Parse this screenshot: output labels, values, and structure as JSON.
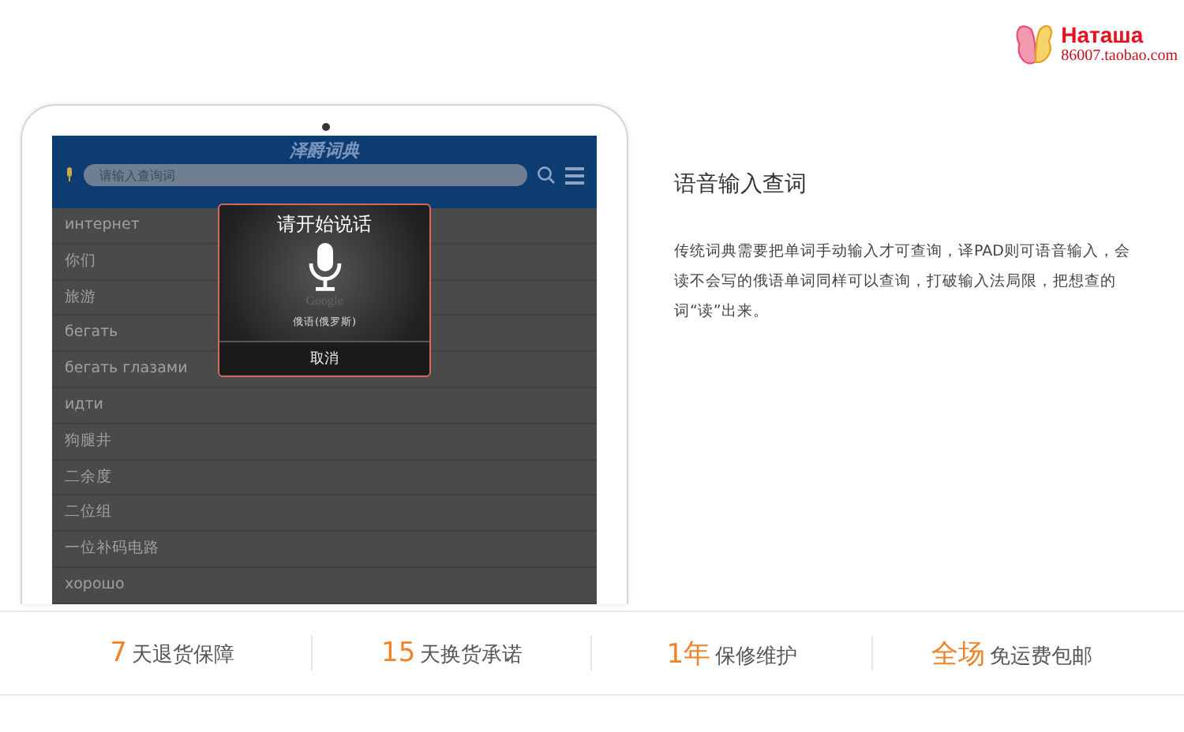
{
  "logo": {
    "name": "Наташа",
    "url": "86007.taobao.com"
  },
  "app": {
    "title": "泽爵词典",
    "search": {
      "placeholder": "请输入查询词"
    },
    "words": [
      "интернет",
      "你们",
      "旅游",
      "бегать",
      "бегать глазами",
      "идти",
      "狗腿井",
      "二余度",
      "二位组",
      "一位补码电路",
      "хорошо"
    ],
    "dialog": {
      "title": "请开始说话",
      "brand": "Google",
      "language": "俄语(俄罗斯)",
      "cancel": "取消"
    }
  },
  "feature": {
    "title": "语音输入查词",
    "description": "传统词典需要把单词手动输入才可查询，译PAD则可语音输入，会读不会写的俄语单词同样可以查询，打破输入法局限，把想查的词“读”出来。"
  },
  "guarantees": [
    {
      "number": "7",
      "text": "天退货保障"
    },
    {
      "number": "15",
      "text": "天换货承诺"
    },
    {
      "number": "1年",
      "text": "保修维护"
    },
    {
      "number": "全场",
      "text": "免运费包邮"
    }
  ]
}
